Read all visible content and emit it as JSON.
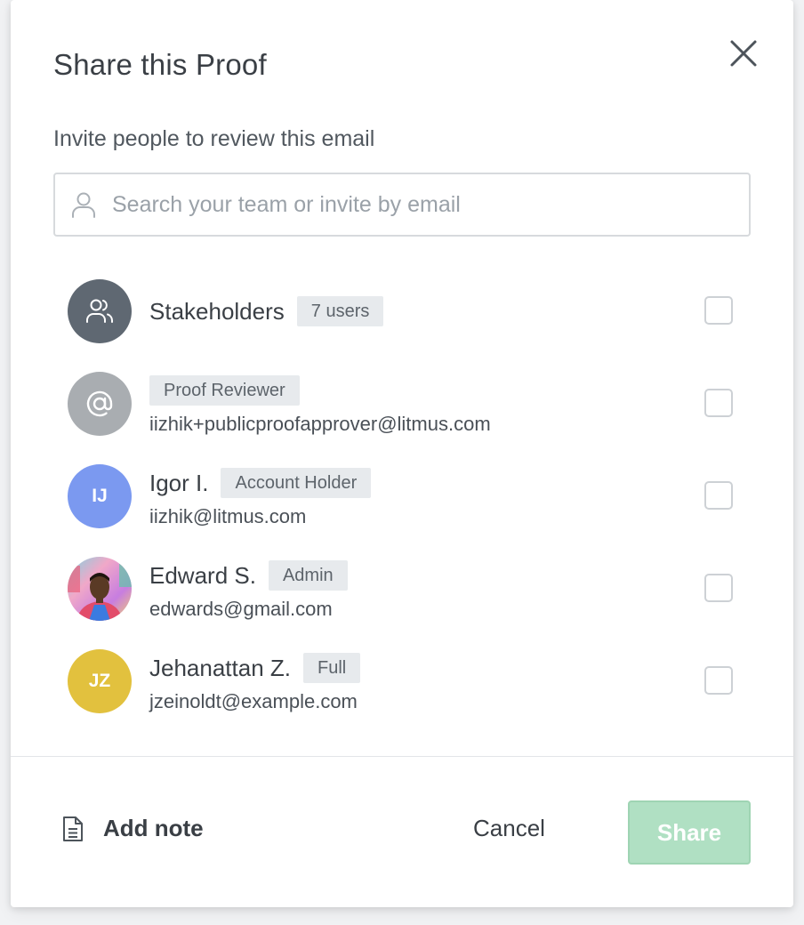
{
  "dialog": {
    "title": "Share this Proof",
    "subtitle": "Invite people to review this email"
  },
  "search": {
    "placeholder": "Search your team or invite by email",
    "value": ""
  },
  "recipients": [
    {
      "name": "Stakeholders",
      "badge": "7 users",
      "email": "",
      "avatar_type": "group-icon",
      "avatar_color": "#5f6872",
      "checked": false
    },
    {
      "name": "",
      "badge": "Proof Reviewer",
      "email": "iizhik+publicproofapprover@litmus.com",
      "avatar_type": "at-icon",
      "avatar_color": "#a9adb1",
      "checked": false
    },
    {
      "name": "Igor I.",
      "badge": "Account Holder",
      "email": "iizhik@litmus.com",
      "initials": "IJ",
      "avatar_color": "#7b99f0",
      "checked": false
    },
    {
      "name": "Edward S.",
      "badge": "Admin",
      "email": "edwards@gmail.com",
      "avatar_type": "photo",
      "checked": false
    },
    {
      "name": "Jehanattan Z.",
      "badge": "Full",
      "email": "jzeinoldt@example.com",
      "initials": "JZ",
      "avatar_color": "#e2c13e",
      "checked": false
    }
  ],
  "footer": {
    "add_note_label": "Add note",
    "cancel_label": "Cancel",
    "share_label": "Share"
  },
  "colors": {
    "share_disabled_bg": "#b0e0c3",
    "badge_bg": "#e7eaed"
  }
}
